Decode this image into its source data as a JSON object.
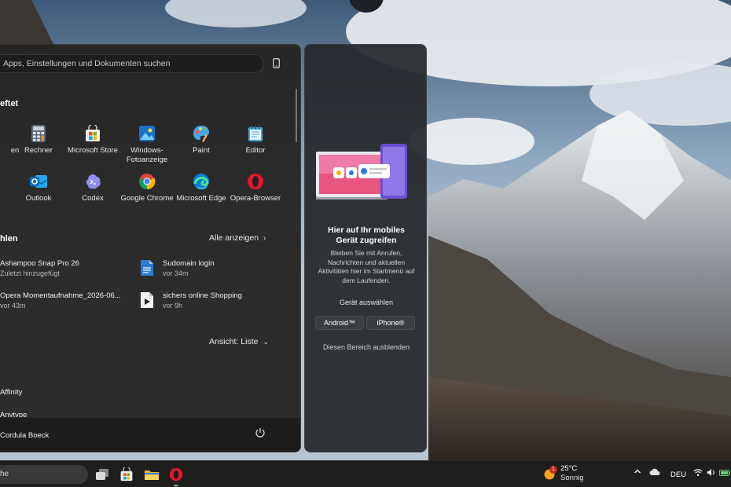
{
  "search": {
    "placeholder": "Apps, Einstellungen und Dokumenten suchen"
  },
  "pinned": {
    "title": "eftet",
    "apps": [
      {
        "label": "en",
        "icon": "app-icon"
      },
      {
        "label": "Rechner",
        "icon": "calculator-icon"
      },
      {
        "label": "Microsoft Store",
        "icon": "store-icon"
      },
      {
        "label": "Windows-Fotoanzeige",
        "line1": "Windows-",
        "line2": "Fotoanzeige",
        "icon": "photos-icon"
      },
      {
        "label": "Paint",
        "icon": "paint-icon"
      },
      {
        "label": "Editor",
        "icon": "notepad-icon"
      },
      {
        "label": "Outlook",
        "icon": "outlook-icon"
      },
      {
        "label": "Codex",
        "icon": "codex-icon"
      },
      {
        "label": "Google Chrome",
        "icon": "chrome-icon"
      },
      {
        "label": "Microsoft Edge",
        "icon": "edge-icon"
      },
      {
        "label": "Opera-Browser",
        "icon": "opera-icon"
      }
    ]
  },
  "recommended": {
    "title": "hlen",
    "show_all": "Alle anzeigen",
    "items": [
      {
        "title": "Ashampoo Snap Pro 26",
        "subtitle": "Zuletzt hinzugefügt"
      },
      {
        "title": "Sudomain login",
        "subtitle": "vor 34m",
        "icon": "document-icon"
      },
      {
        "title": "Opera Momentaufnahme_2026-06...",
        "subtitle": "vor 43m"
      },
      {
        "title": "sichers online Shopping",
        "subtitle": "vor 9h",
        "icon": "video-file-icon"
      }
    ]
  },
  "all_apps": {
    "view_label": "Ansicht: Liste",
    "items": [
      "Affinity",
      "Anytype"
    ]
  },
  "user": {
    "name": "Cordula Boeck"
  },
  "phone_panel": {
    "title": "Hier auf Ihr mobiles Gerät zugreifen",
    "title_line1": "Hier auf Ihr mobiles",
    "title_line2": "Gerät zugreifen",
    "description": "Bleiben Sie mit Anrufen, Nachrichten und aktuellen Aktivitäten hier im Startmenü auf dem Laufenden.",
    "select_device": "Gerät auswählen",
    "android": "Android™",
    "iphone": "iPhone®",
    "hide": "Diesen Bereich ausblenden"
  },
  "taskbar": {
    "search_text": "he",
    "weather": {
      "temp": "25°C",
      "condition": "Sonnig",
      "badge": "1"
    },
    "language": "DEU"
  },
  "colors": {
    "accent": "#0078d4",
    "panel": "#242221",
    "taskbar": "#1f1e1d"
  }
}
